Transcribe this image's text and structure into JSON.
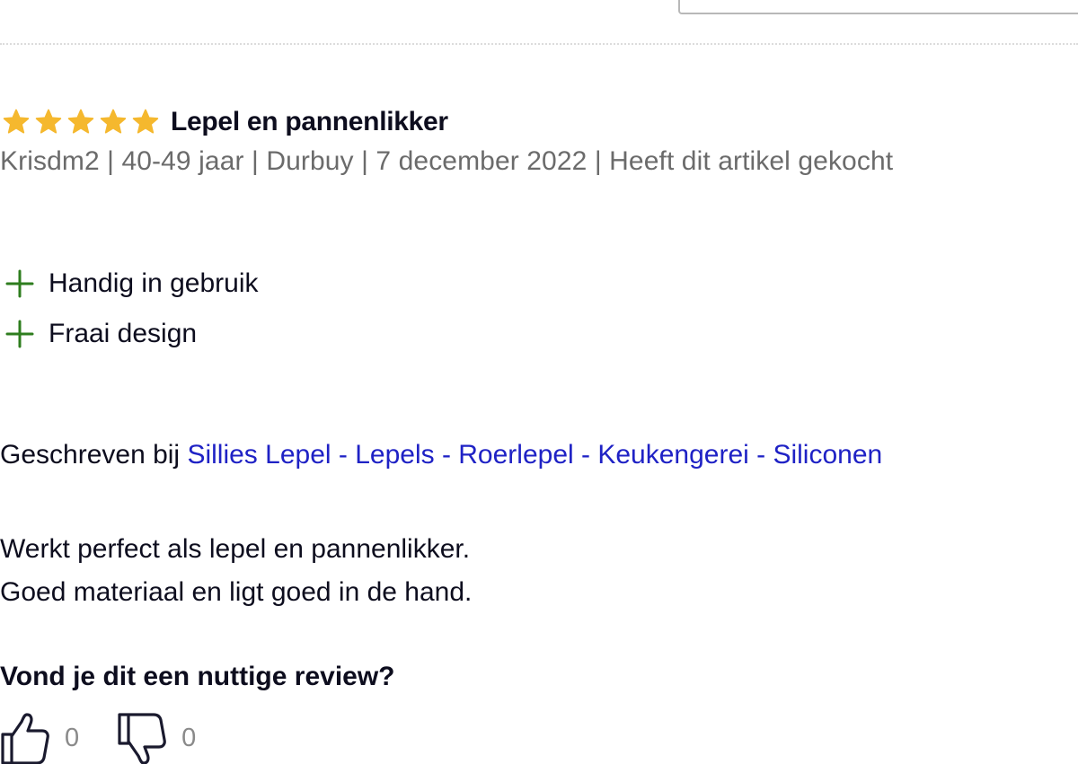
{
  "review": {
    "rating": 5,
    "rating_max": 5,
    "star_color": "#f5b82e",
    "title": "Lepel en pannenlikker",
    "meta": "Krisdm2 | 40-49 jaar | Durbuy | 7 december 2022 | Heeft dit artikel gekocht",
    "pros": [
      {
        "icon": "plus-icon",
        "label": "Handig in gebruik"
      },
      {
        "icon": "plus-icon",
        "label": "Fraai design"
      }
    ],
    "pros_color": "#2e7d1e",
    "written_prefix": "Geschreven bij",
    "product_link": "Sillies Lepel - Lepels - Roerlepel - Keukengerei - Siliconen",
    "link_color": "#1f22c5",
    "body_lines": [
      "Werkt perfect als lepel en pannenlikker.",
      "Goed materiaal en ligt goed in de hand."
    ]
  },
  "helpful": {
    "question": "Vond je dit een nuttige review?",
    "up": {
      "icon": "thumbs-up-icon",
      "count": "0"
    },
    "down": {
      "icon": "thumbs-down-icon",
      "count": "0"
    }
  }
}
